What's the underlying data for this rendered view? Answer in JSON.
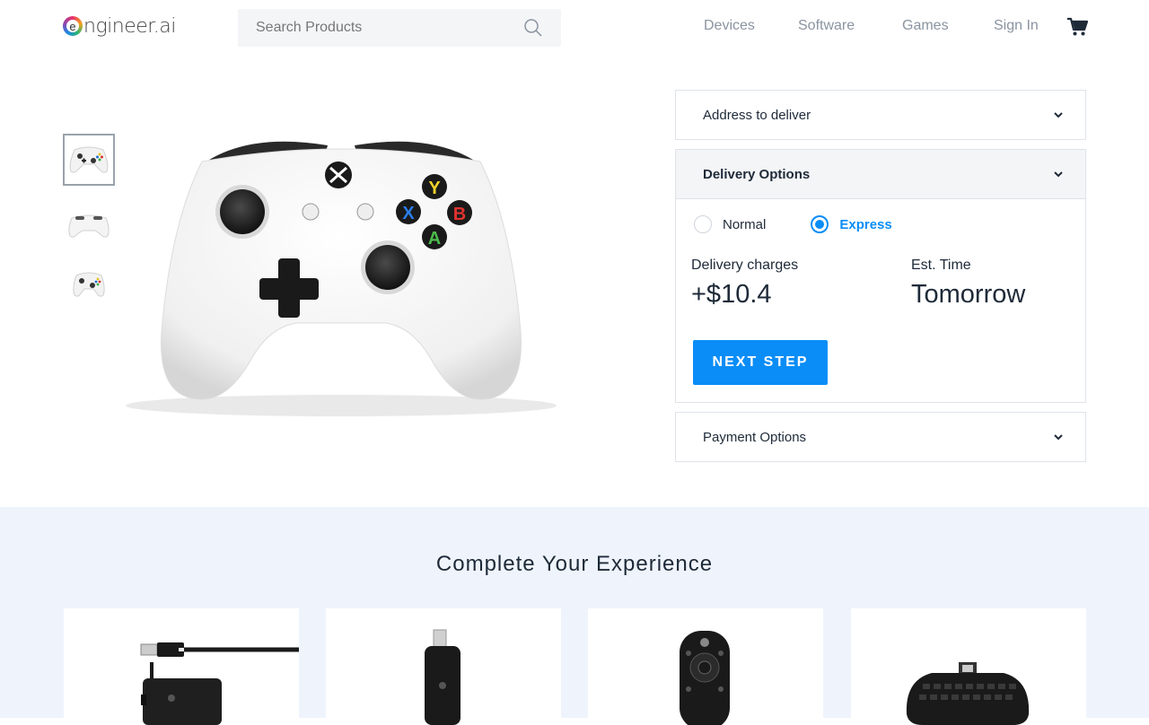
{
  "header": {
    "logo_letter": "e",
    "logo_text": "ngineer.ai",
    "search_placeholder": "Search Products",
    "nav": [
      "Devices",
      "Software",
      "Games",
      "Sign In"
    ]
  },
  "product": {
    "thumbnails": [
      "Controller front view",
      "Controller top view",
      "Controller angled view"
    ]
  },
  "checkout": {
    "address_label": "Address to deliver",
    "delivery_label": "Delivery Options",
    "delivery_options": [
      "Normal",
      "Express"
    ],
    "selected_option": "Express",
    "charges_label": "Delivery charges",
    "charges_value": "+$10.4",
    "time_label": "Est. Time",
    "time_value": "Tomorrow",
    "next_button": "NEXT STEP",
    "payment_label": "Payment Options"
  },
  "recommend": {
    "title": "Complete Your Experience",
    "items": [
      "Play & Charge Kit",
      "Wireless Adapter",
      "Media Remote",
      "Chatpad"
    ]
  },
  "colors": {
    "accent": "#0a8df7",
    "panel_bg": "#f4f5f7",
    "section_bg": "#eff4fc"
  }
}
